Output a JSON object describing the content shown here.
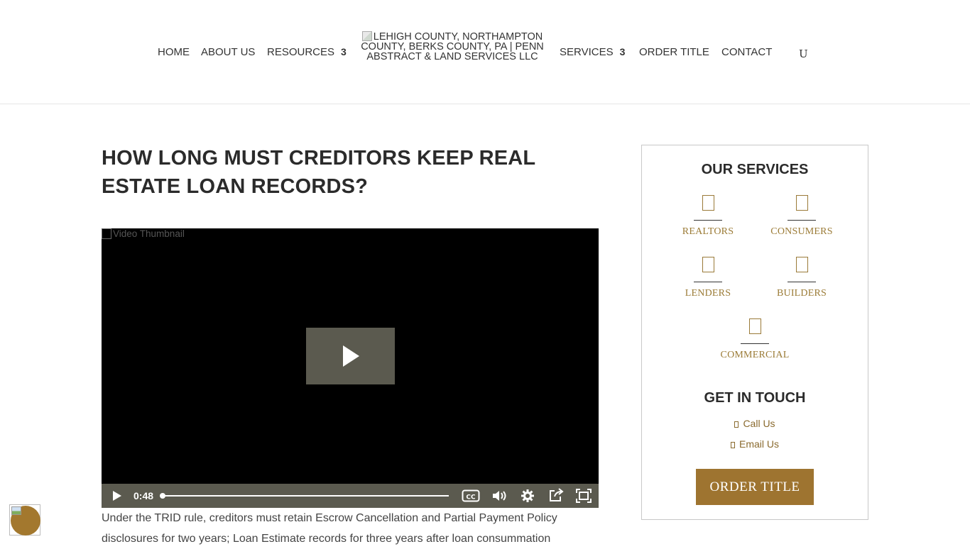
{
  "nav": {
    "home": "HOME",
    "about": "ABOUT US",
    "resources": "RESOURCES",
    "resources_caret": "3",
    "logo_alt": "LEHIGH COUNTY, NORTHAMPTON COUNTY, BERKS COUNTY, PA | PENN ABSTRACT & LAND SERVICES LLC",
    "services": "SERVICES",
    "services_caret": "3",
    "order_title": "ORDER TITLE",
    "contact": "CONTACT",
    "search_glyph": "U"
  },
  "main": {
    "title": "HOW LONG MUST CREDITORS KEEP REAL ESTATE LOAN RECORDS?",
    "video": {
      "thumbnail_alt": "Video Thumbnail",
      "time": "0:48",
      "progress": 0
    },
    "body_text": "Under the TRID rule, creditors must retain Escrow Cancellation and Partial Payment Policy disclosures for two years; Loan Estimate records for three years after loan consummation"
  },
  "sidebar": {
    "services_heading": "OUR SERVICES",
    "services": [
      {
        "label": "REALTORS",
        "icon": "realtors-icon"
      },
      {
        "label": "CONSUMERS",
        "icon": "consumers-icon"
      },
      {
        "label": "LENDERS",
        "icon": "lenders-icon"
      },
      {
        "label": "BUILDERS",
        "icon": "builders-icon"
      },
      {
        "label": "COMMERCIAL",
        "icon": "commercial-icon"
      }
    ],
    "contact_heading": "GET IN TOUCH",
    "call_label": "Call Us",
    "email_label": "Email Us",
    "order_button": "ORDER TITLE"
  },
  "colors": {
    "accent_gold": "#9e7430",
    "video_bar": "#5b5a4f",
    "text_dark": "#2b2b2b"
  }
}
